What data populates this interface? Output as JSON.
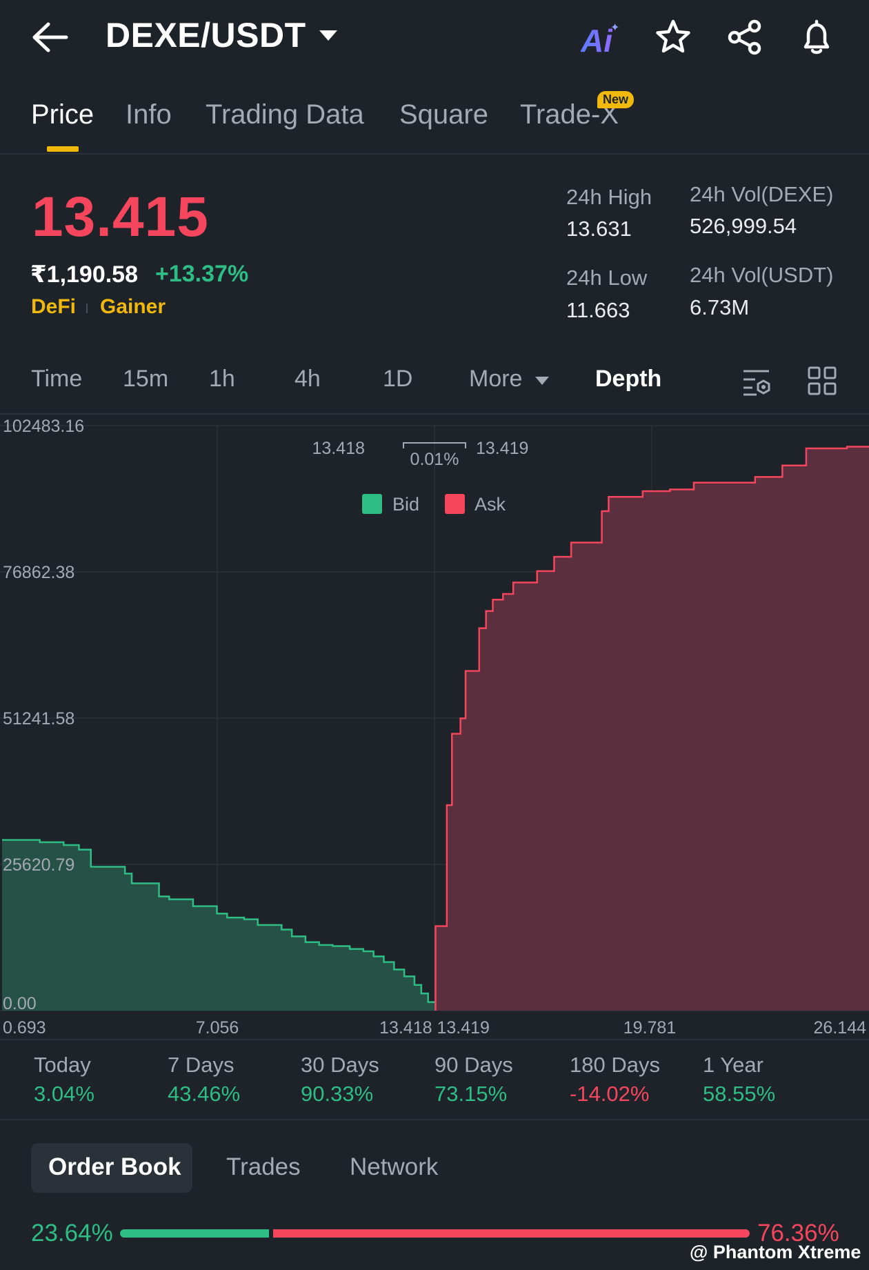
{
  "header": {
    "pair": "DEXE/USDT",
    "ai_label": "Ai",
    "icons": [
      "back-arrow-icon",
      "chevron-down-icon",
      "ai-icon",
      "star-icon",
      "share-icon",
      "bell-icon"
    ]
  },
  "tabs": [
    {
      "label": "Price",
      "active": true
    },
    {
      "label": "Info"
    },
    {
      "label": "Trading Data"
    },
    {
      "label": "Square"
    },
    {
      "label": "Trade-X",
      "badge": "New"
    }
  ],
  "price": {
    "last": "13.415",
    "fiat": "₹1,190.58",
    "change": "+13.37%",
    "tags": [
      "DeFi",
      "Gainer"
    ]
  },
  "stats": {
    "high_label": "24h High",
    "high": "13.631",
    "low_label": "24h Low",
    "low": "11.663",
    "vol_base_label": "24h Vol(DEXE)",
    "vol_base": "526,999.54",
    "vol_quote_label": "24h Vol(USDT)",
    "vol_quote": "6.73M"
  },
  "intervals": {
    "items": [
      "Time",
      "15m",
      "1h",
      "4h",
      "1D"
    ],
    "more": "More",
    "depth": "Depth"
  },
  "chart_data": {
    "type": "area",
    "title": "",
    "bid_price": "13.418",
    "ask_price": "13.419",
    "spread": "0.01%",
    "legend": [
      {
        "name": "Bid",
        "color": "#2ebd85"
      },
      {
        "name": "Ask",
        "color": "#f6465d"
      }
    ],
    "y_ticks": [
      "102483.16",
      "76862.38",
      "51241.58",
      "25620.79",
      "0.00"
    ],
    "x_ticks": [
      "0.693",
      "7.056",
      "13.418 13.419",
      "19.781",
      "26.144"
    ],
    "ylim": [
      0,
      102483.16
    ],
    "xlim": [
      0.693,
      26.144
    ],
    "series": [
      {
        "name": "Bid",
        "color": "#2ebd85",
        "x": [
          0.693,
          1.8,
          2.5,
          2.95,
          3.3,
          4.3,
          4.5,
          5.3,
          5.6,
          6.3,
          7.0,
          7.3,
          7.8,
          8.2,
          8.9,
          9.2,
          9.6,
          10.0,
          10.4,
          10.9,
          11.3,
          11.6,
          11.9,
          12.2,
          12.5,
          12.8,
          13.0,
          13.2,
          13.418
        ],
        "values": [
          29900,
          29500,
          29000,
          28200,
          25200,
          24000,
          22300,
          20000,
          19500,
          18300,
          17000,
          16300,
          16000,
          15000,
          14200,
          13000,
          12000,
          11500,
          11300,
          10800,
          10400,
          9500,
          8500,
          7200,
          6000,
          4500,
          3000,
          1500,
          0
        ]
      },
      {
        "name": "Ask",
        "color": "#f6465d",
        "x": [
          13.419,
          13.75,
          13.9,
          14.15,
          14.3,
          14.7,
          14.9,
          15.1,
          15.4,
          15.7,
          16.4,
          16.9,
          17.4,
          18.3,
          18.5,
          19.5,
          20.3,
          21.0,
          22.8,
          23.6,
          24.3,
          25.5,
          26.144
        ],
        "values": [
          0,
          14800,
          36000,
          48500,
          51200,
          59500,
          67000,
          70000,
          72000,
          73000,
          75000,
          77000,
          79500,
          82000,
          87500,
          90000,
          91000,
          91300,
          92500,
          93500,
          95500,
          98500,
          98800
        ]
      }
    ]
  },
  "performance": [
    {
      "label": "Today",
      "value": "3.04%",
      "color": "#2ebd85"
    },
    {
      "label": "7 Days",
      "value": "43.46%",
      "color": "#2ebd85"
    },
    {
      "label": "30 Days",
      "value": "90.33%",
      "color": "#2ebd85"
    },
    {
      "label": "90 Days",
      "value": "73.15%",
      "color": "#2ebd85"
    },
    {
      "label": "180 Days",
      "value": "-14.02%",
      "color": "#f6465d"
    },
    {
      "label": "1 Year",
      "value": "58.55%",
      "color": "#2ebd85"
    }
  ],
  "bottom_tabs": [
    "Order Book",
    "Trades",
    "Network"
  ],
  "order_ratio": {
    "bid": "23.64%",
    "ask": "76.36%",
    "bid_fraction": 0.2364
  },
  "watermark": "@ Phantom Xtreme",
  "colors": {
    "bg": "#1e2329",
    "accent": "#f0b90b",
    "up": "#2ebd85",
    "down": "#f6465d"
  }
}
